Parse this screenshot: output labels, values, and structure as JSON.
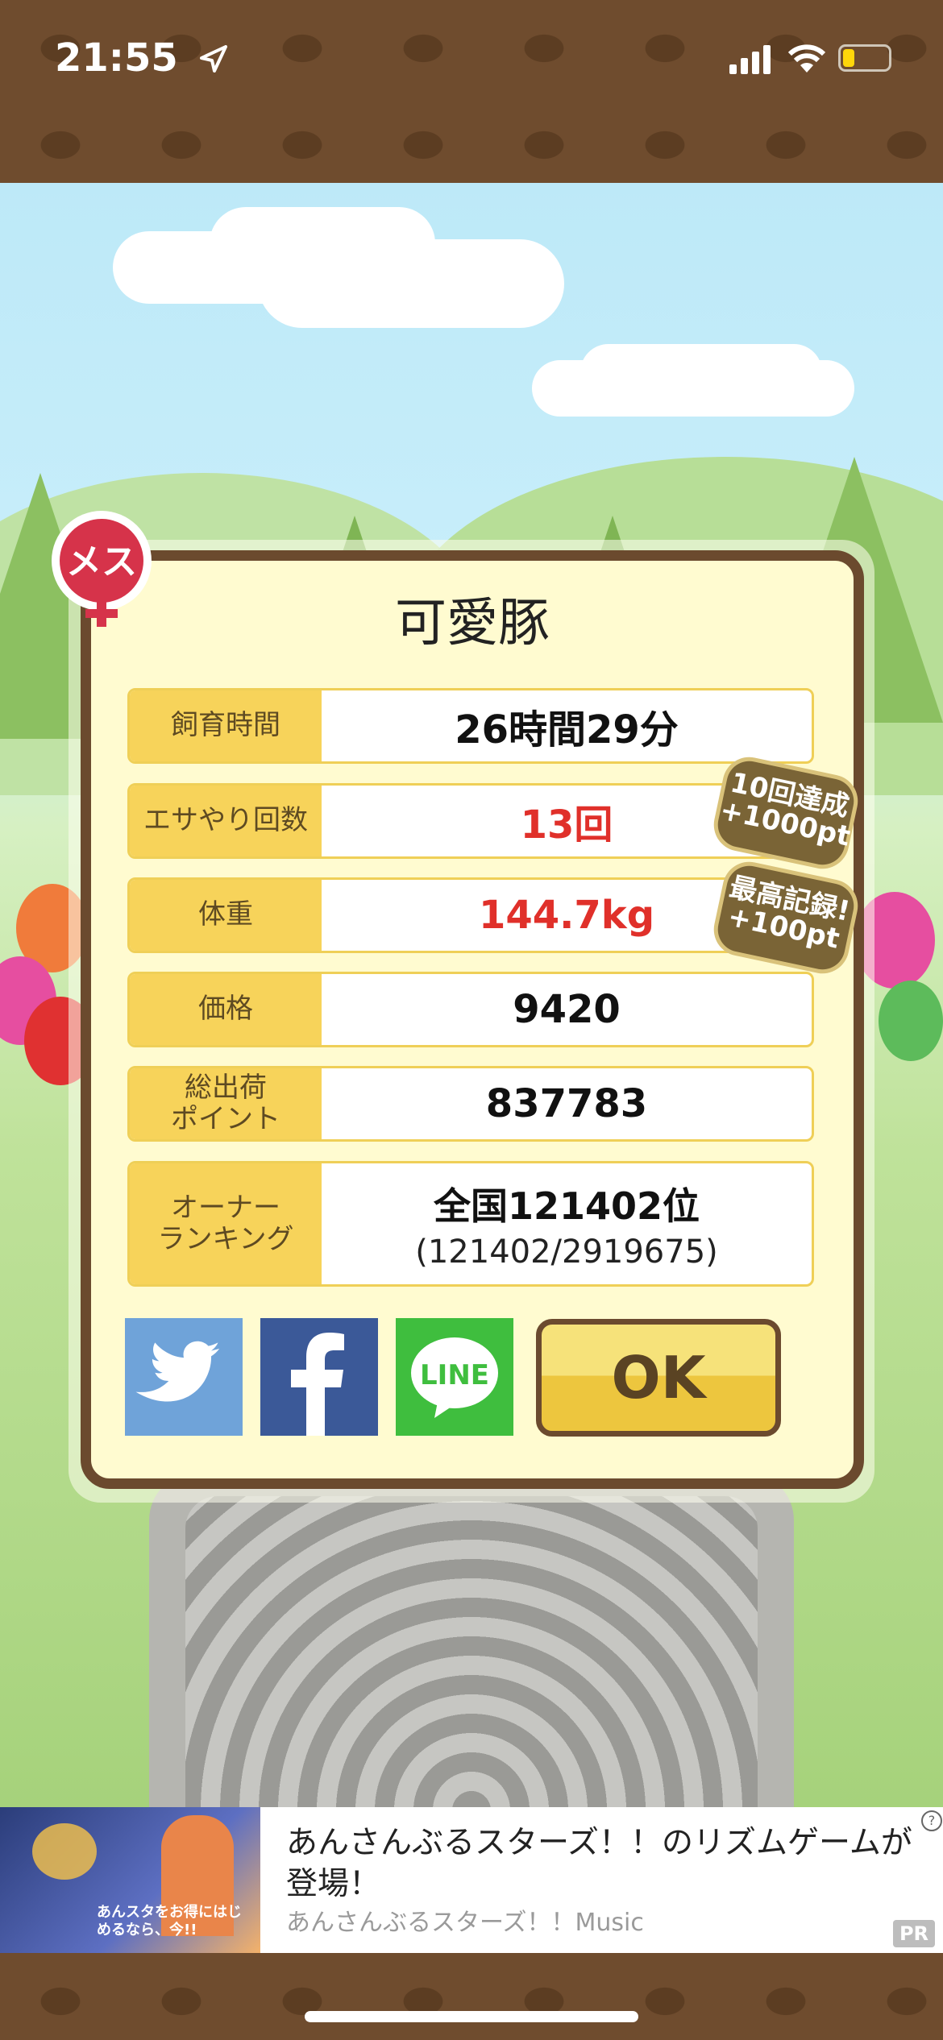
{
  "status_bar": {
    "time": "21:55"
  },
  "dialog": {
    "gender_badge": "メス",
    "title": "可愛豚",
    "rows": [
      {
        "label": "飼育時間",
        "value": "26時間29分",
        "highlight": false
      },
      {
        "label": "エサやり回数",
        "value": "13回",
        "highlight": true
      },
      {
        "label": "体重",
        "value": "144.7kg",
        "highlight": true
      },
      {
        "label": "価格",
        "value": "9420",
        "highlight": false
      },
      {
        "label": "総出荷\nポイント",
        "value": "837783",
        "highlight": false
      },
      {
        "label": "オーナー\nランキング",
        "value": "全国121402位",
        "sub_value": "(121402/2919675)",
        "highlight": false
      }
    ],
    "bonuses": [
      {
        "line1": "10回達成",
        "line2": "+1000pt"
      },
      {
        "line1": "最高記録!",
        "line2": "+100pt"
      }
    ],
    "share_buttons": {
      "line_label": "LINE"
    },
    "ok_label": "OK"
  },
  "ad": {
    "headline": "あんさんぶるスターズ！！のリズムゲームが登場！",
    "source": "あんさんぶるスターズ！！Music",
    "pr_label": "PR",
    "info_icon": "?",
    "image_text": "あんスタをお得にはじめるなら、今!!"
  },
  "colors": {
    "accent_red": "#e0302a",
    "label_yellow": "#f7d35a",
    "frame_brown": "#6b4a2e"
  }
}
